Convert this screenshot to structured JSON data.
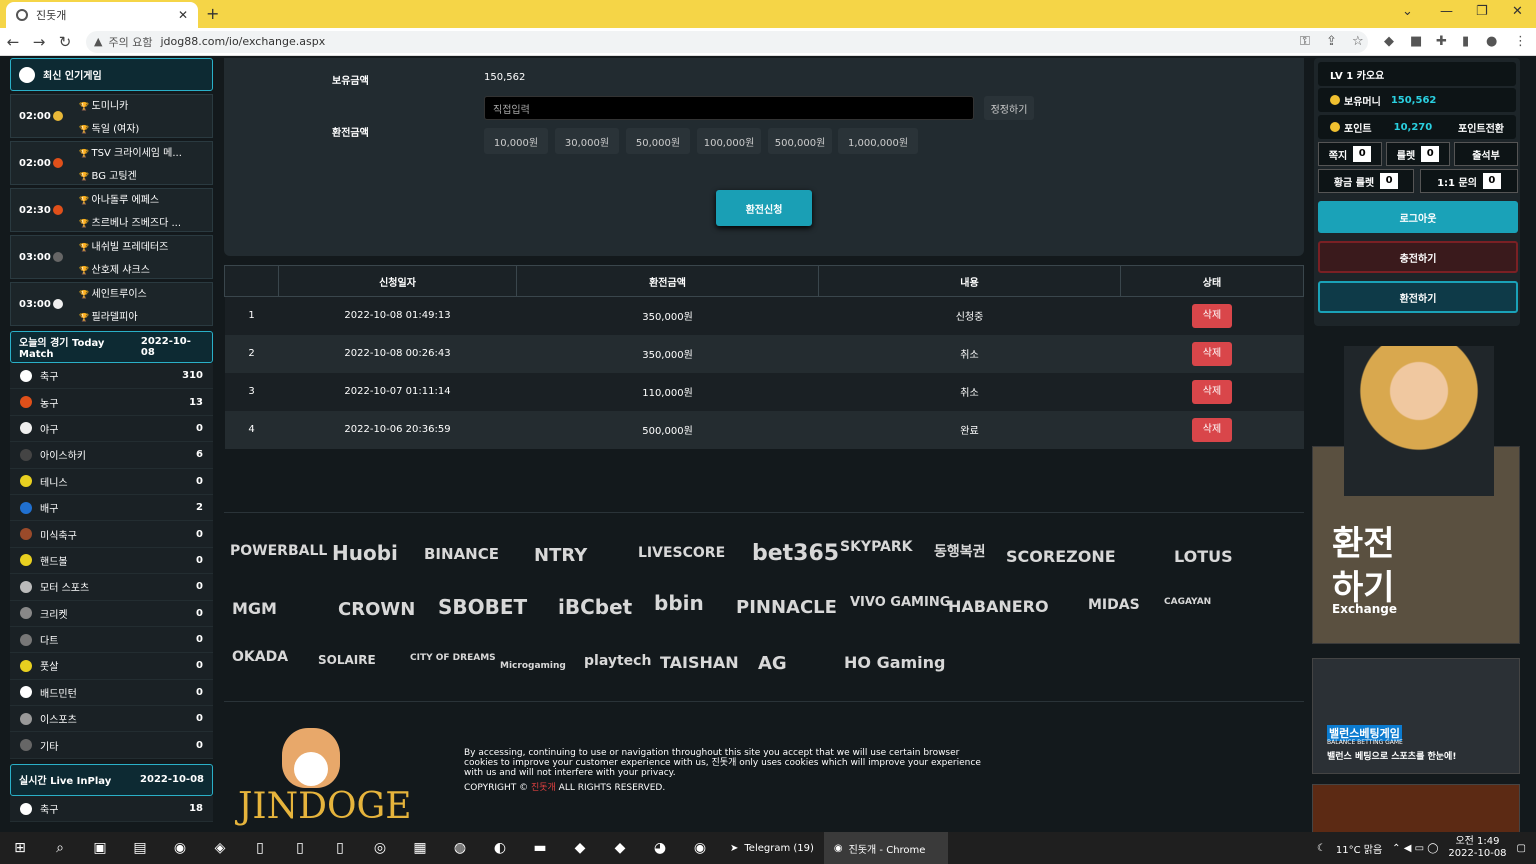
{
  "browser": {
    "tab_title": "진돗개",
    "address_warning": "주의 요함",
    "url": "jdog88.com/io/exchange.aspx"
  },
  "left": {
    "popular_title": "최신 인기게임",
    "games": [
      {
        "time": "02:00",
        "home": "도미니카",
        "away": "독일 (여자)",
        "dot": "#e8b838"
      },
      {
        "time": "02:00",
        "home": "TSV 크라이세임 메...",
        "away": "BG 고팅겐",
        "dot": "#e0501a"
      },
      {
        "time": "02:30",
        "home": "아나돌루 에페스",
        "away": "츠르베나 즈베즈다 ...",
        "dot": "#e0501a"
      },
      {
        "time": "03:00",
        "home": "내쉬빌 프레데터즈",
        "away": "산호제 샤크스",
        "dot": "#666"
      },
      {
        "time": "03:00",
        "home": "세인트루이스",
        "away": "필라델피아",
        "dot": "#f0f0f0"
      }
    ],
    "today_label": "오늘의 경기 Today Match",
    "today_date": "2022-10-08",
    "sports": [
      {
        "name": "축구",
        "count": "310",
        "color": "#ffffff"
      },
      {
        "name": "농구",
        "count": "13",
        "color": "#e0501a"
      },
      {
        "name": "야구",
        "count": "0",
        "color": "#f0f0f0"
      },
      {
        "name": "아이스하키",
        "count": "6",
        "color": "#444444"
      },
      {
        "name": "테니스",
        "count": "0",
        "color": "#e8d020"
      },
      {
        "name": "배구",
        "count": "2",
        "color": "#2070d0"
      },
      {
        "name": "미식축구",
        "count": "0",
        "color": "#9a4a2a"
      },
      {
        "name": "핸드볼",
        "count": "0",
        "color": "#e8d020"
      },
      {
        "name": "모터 스포츠",
        "count": "0",
        "color": "#bbbbbb"
      },
      {
        "name": "크리켓",
        "count": "0",
        "color": "#888888"
      },
      {
        "name": "다트",
        "count": "0",
        "color": "#777777"
      },
      {
        "name": "풋살",
        "count": "0",
        "color": "#e8d020"
      },
      {
        "name": "배드민턴",
        "count": "0",
        "color": "#ffffff"
      },
      {
        "name": "이스포츠",
        "count": "0",
        "color": "#999999"
      },
      {
        "name": "기타",
        "count": "0",
        "color": "#666666"
      }
    ],
    "live_label": "실시간 Live InPlay",
    "live_date": "2022-10-08",
    "live_sports": [
      {
        "name": "축구",
        "count": "18",
        "color": "#ffffff"
      }
    ]
  },
  "form": {
    "balance_label": "보유금액",
    "balance_value": "150,562",
    "exchange_label": "환전금액",
    "input_placeholder": "직접입력",
    "correct_btn": "정정하기",
    "amounts": [
      "10,000원",
      "30,000원",
      "50,000원",
      "100,000원",
      "500,000원",
      "1,000,000원"
    ],
    "submit": "환전신청"
  },
  "table": {
    "headers": [
      "",
      "신청일자",
      "환전금액",
      "내용",
      "상태"
    ],
    "rows": [
      {
        "no": "1",
        "date": "2022-10-08 01:49:13",
        "amount": "350,000원",
        "content": "신청중",
        "status": "삭제"
      },
      {
        "no": "2",
        "date": "2022-10-08 00:26:43",
        "amount": "350,000원",
        "content": "취소",
        "status": "삭제"
      },
      {
        "no": "3",
        "date": "2022-10-07 01:11:14",
        "amount": "110,000원",
        "content": "취소",
        "status": "삭제"
      },
      {
        "no": "4",
        "date": "2022-10-06 20:36:59",
        "amount": "500,000원",
        "content": "완료",
        "status": "삭제"
      }
    ]
  },
  "partners": [
    "POWERBALL",
    "Huobi",
    "BINANCE",
    "NTRY",
    "LIVESCORE",
    "bet365",
    "SKYPARK",
    "동행복권",
    "SCOREZONE",
    "LOTUS",
    "MGM",
    "CROWN",
    "SBOBET",
    "iBCbet",
    "bbin",
    "PINNACLE",
    "VIVO GAMING",
    "HABANERO",
    "MIDAS",
    "CAGAYAN",
    "OKADA",
    "SOLAIRE",
    "CITY OF DREAMS",
    "Microgaming",
    "playtech",
    "TAISHAN",
    "AG",
    "HO Gaming"
  ],
  "footer": {
    "brand": "JINDOGE",
    "disclaimer": "By accessing, continuing to use or navigation throughout this site you accept that we will use certain browser cookies to improve your customer experience with us, 진돗개 only uses cookies which will improve your experience with us and will not interfere with your privacy.",
    "copyright_prefix": "COPYRIGHT © ",
    "copyright_name": "진돗개",
    "copyright_suffix": " ALL RIGHTS RESERVED."
  },
  "account": {
    "level": "LV 1 카오요",
    "money_label": "보유머니",
    "money_value": "150,562",
    "point_label": "포인트",
    "point_value": "10,270",
    "point_exchange": "포인트전환",
    "note_label": "쪽지",
    "note_count": "0",
    "roulette_label": "룰렛",
    "roulette_count": "0",
    "attendance": "출석부",
    "gold_roulette_label": "황금 룰렛",
    "gold_roulette_count": "0",
    "inquiry_label": "1:1 문의",
    "inquiry_count": "0",
    "logout": "로그아웃",
    "deposit": "충전하기",
    "withdraw": "환전하기"
  },
  "banners": {
    "exchange_title": "환전\n하기",
    "exchange_sub": "Exchange",
    "balance_title": "밸런스베팅게임",
    "balance_sub": "BALANCE BETTING GAME",
    "balance_desc": "밸런스 베팅으로 스포츠를 한눈에!"
  },
  "taskbar": {
    "telegram": "Telegram (19)",
    "chrome": "진돗개 - Chrome",
    "weather": "11°C 맑음",
    "time": "오전 1:49",
    "date": "2022-10-08"
  }
}
